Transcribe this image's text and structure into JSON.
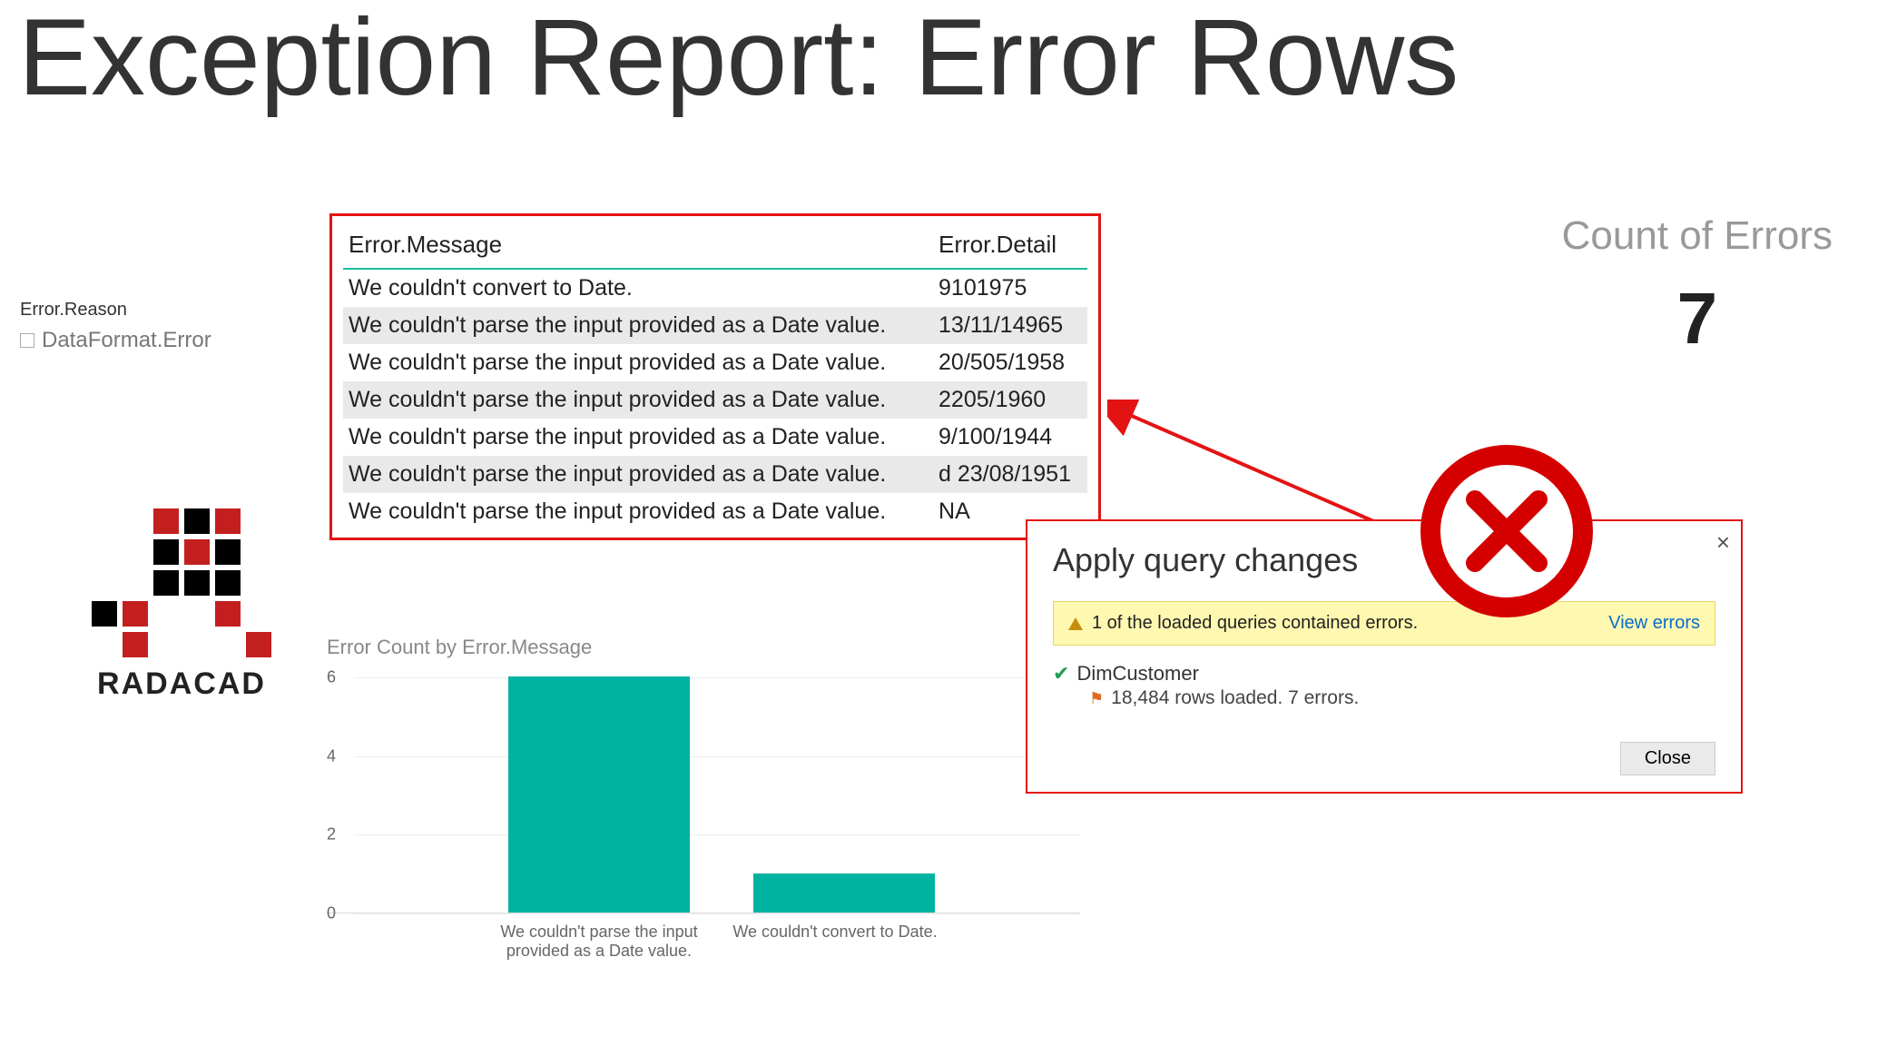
{
  "title": "Exception Report: Error Rows",
  "slicer": {
    "label": "Error.Reason",
    "items": [
      "DataFormat.Error"
    ]
  },
  "logo_text": "RADACAD",
  "table": {
    "headers": [
      "Error.Message",
      "Error.Detail"
    ],
    "rows": [
      {
        "msg": "We couldn't convert to Date.",
        "detail": "9101975"
      },
      {
        "msg": "We couldn't parse the input provided as a Date value.",
        "detail": "13/11/14965"
      },
      {
        "msg": "We couldn't parse the input provided as a Date value.",
        "detail": "20/505/1958"
      },
      {
        "msg": "We couldn't parse the input provided as a Date value.",
        "detail": "2205/1960"
      },
      {
        "msg": "We couldn't parse the input provided as a Date value.",
        "detail": "9/100/1944"
      },
      {
        "msg": "We couldn't parse the input provided as a Date value.",
        "detail": "d 23/08/1951"
      },
      {
        "msg": "We couldn't parse the input provided as a Date value.",
        "detail": "NA"
      }
    ]
  },
  "count_card": {
    "label": "Count of Errors",
    "value": "7"
  },
  "chart_data": {
    "type": "bar",
    "title": "Error Count by Error.Message",
    "categories": [
      "We couldn't parse the input provided as a Date value.",
      "We couldn't convert to Date."
    ],
    "values": [
      6,
      1
    ],
    "ylim": [
      0,
      6
    ],
    "yticks": [
      0,
      2,
      4,
      6
    ]
  },
  "dialog": {
    "title": "Apply query changes",
    "warn_msg": "1 of the loaded queries contained errors.",
    "view_errors_label": "View errors",
    "query_name": "DimCustomer",
    "query_status": "18,484 rows loaded. 7 errors.",
    "close_label": "Close"
  }
}
